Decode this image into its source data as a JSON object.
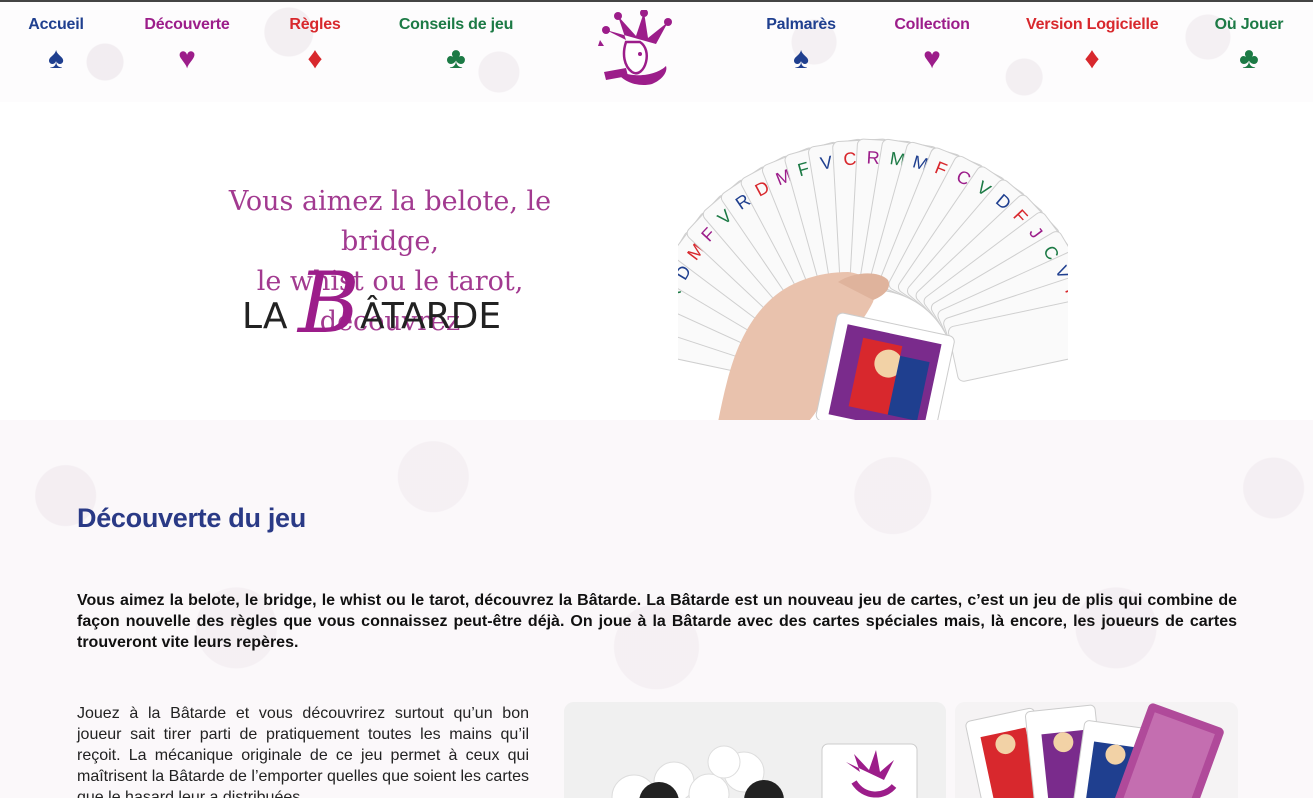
{
  "nav": {
    "left": [
      {
        "label": "Accueil",
        "suit": "♠",
        "color": "blue"
      },
      {
        "label": "Découverte",
        "suit": "♥",
        "color": "purple"
      },
      {
        "label": "Règles",
        "suit": "♦",
        "color": "red"
      },
      {
        "label": "Conseils de jeu",
        "suit": "♣",
        "color": "green"
      }
    ],
    "right": [
      {
        "label": "Palmarès",
        "suit": "♠",
        "color": "blue"
      },
      {
        "label": "Collection",
        "suit": "♥",
        "color": "purple"
      },
      {
        "label": "Version Logicielle",
        "suit": "♦",
        "color": "red"
      },
      {
        "label": "Où Jouer",
        "suit": "♣",
        "color": "green"
      }
    ]
  },
  "hero": {
    "tagline_line1": "Vous aimez la belote, le bridge,",
    "tagline_line2": "le whist ou le tarot, découvrez",
    "brand_la": "LA",
    "brand_b": "B",
    "brand_rest": "ÂTARDE"
  },
  "content": {
    "title": "Découverte du jeu",
    "intro": "Vous aimez la belote, le bridge, le whist ou le tarot, découvrez la Bâtarde. La Bâtarde est un nouveau jeu de cartes, c’est un jeu de plis qui combine de façon nouvelle des règles que vous connaissez peut-être déjà. On joue à la Bâtarde avec des cartes spéciales mais, là encore, les joueurs de cartes trouveront vite leurs repères.",
    "body": "Jouez à la Bâtarde et vous découvrirez surtout qu’un bon joueur sait tirer parti de pratiquement toutes les mains qu’il reçoit. La mécanique originale de ce jeu permet à ceux qui maîtrisent la Bâtarde de l’emporter quelles que soient les cartes que le hasard leur a distribuées."
  },
  "colors": {
    "blue": "#1f3f8f",
    "purple": "#9c1d8a",
    "red": "#d8282d",
    "green": "#1c7a45"
  }
}
